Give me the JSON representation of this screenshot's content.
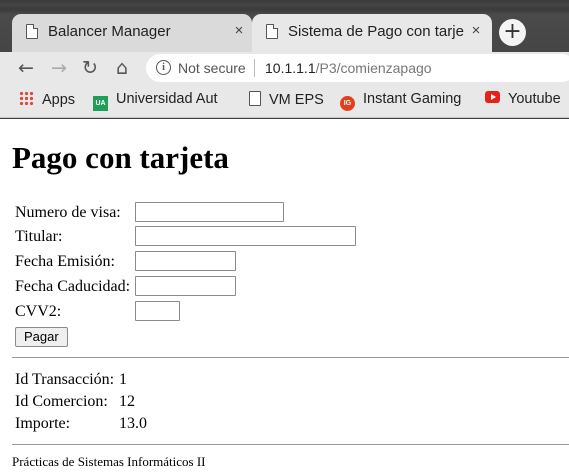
{
  "browser": {
    "tabs": [
      {
        "title": "Balancer Manager",
        "close": "×",
        "active": false
      },
      {
        "title": "Sistema de Pago con tarje",
        "close": "×",
        "active": true
      }
    ],
    "new_tab": "+",
    "nav": {
      "back": "←",
      "forward": "→",
      "reload": "↻",
      "home": "⌂"
    },
    "address": {
      "info_icon": "i",
      "security_label": "Not secure",
      "host": "10.1.1.1",
      "path": "/P3/comienzapago"
    },
    "bookmarks": [
      {
        "label": "Apps",
        "icon": "apps-grid-icon"
      },
      {
        "label": "Universidad Aut",
        "icon": "university-icon",
        "icon_text": "UA"
      },
      {
        "label": "VM EPS",
        "icon": "document-icon"
      },
      {
        "label": "Instant Gaming",
        "icon": "instant-gaming-icon",
        "icon_text": "IG"
      },
      {
        "label": "Youtube",
        "icon": "youtube-icon"
      }
    ]
  },
  "page": {
    "title": "Pago con tarjeta",
    "form": {
      "fields": [
        {
          "label": "Numero de visa:",
          "value": ""
        },
        {
          "label": "Titular:",
          "value": ""
        },
        {
          "label": "Fecha Emisión:",
          "value": ""
        },
        {
          "label": "Fecha Caducidad:",
          "value": ""
        },
        {
          "label": "CVV2:",
          "value": ""
        }
      ],
      "submit_label": "Pagar"
    },
    "info": [
      {
        "label": "Id Transacción:",
        "value": "1"
      },
      {
        "label": "Id Comercion:",
        "value": "12"
      },
      {
        "label": "Importe:",
        "value": "13.0"
      }
    ],
    "footer": "Prácticas de Sistemas Informáticos II"
  }
}
